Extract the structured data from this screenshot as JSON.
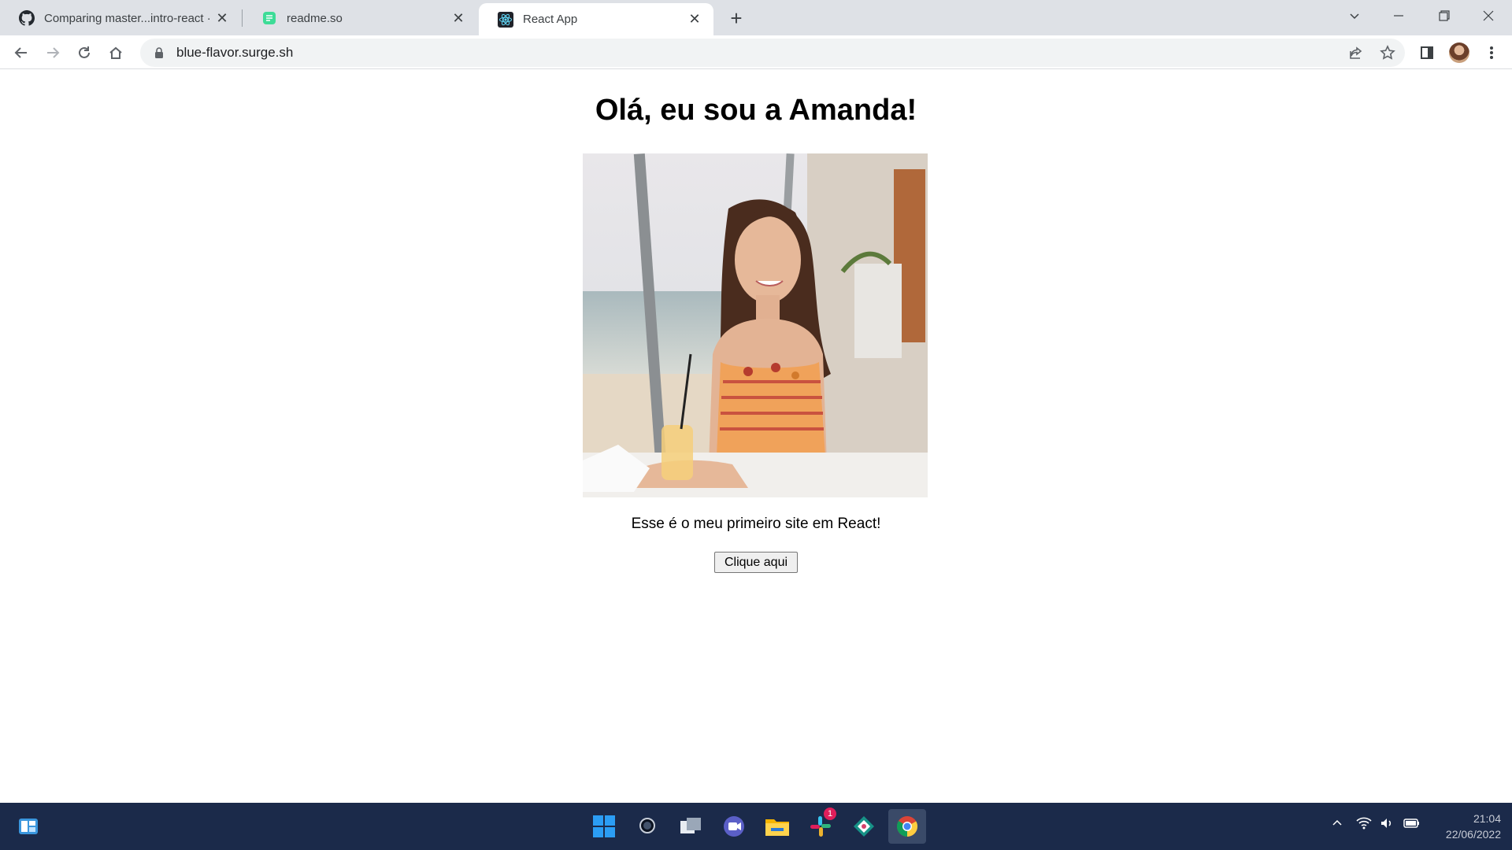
{
  "browser": {
    "tabs": [
      {
        "title": "Comparing master...intro-react · ",
        "favicon": "github-icon",
        "active": false
      },
      {
        "title": "readme.so",
        "favicon": "readme-so-icon",
        "active": false
      },
      {
        "title": "React App",
        "favicon": "react-icon",
        "active": true
      }
    ],
    "url": "blue-flavor.surge.sh"
  },
  "page": {
    "heading": "Olá, eu sou a Amanda!",
    "subtitle": "Esse é o meu primeiro site em React!",
    "button_label": "Clique aqui",
    "photo_alt": "profile-photo"
  },
  "taskbar": {
    "badge_count": "1",
    "time": "21:04",
    "date": "22/06/2022",
    "apps": [
      "widgets-icon",
      "windows-start-icon",
      "search-icon",
      "task-view-icon",
      "teams-chat-icon",
      "file-explorer-icon",
      "slack-icon",
      "git-kraken-icon",
      "chrome-icon"
    ]
  },
  "colors": {
    "tabstrip_bg": "#dee1e6",
    "taskbar_bg": "#1b2a4a",
    "accent": "#0b57d0"
  }
}
